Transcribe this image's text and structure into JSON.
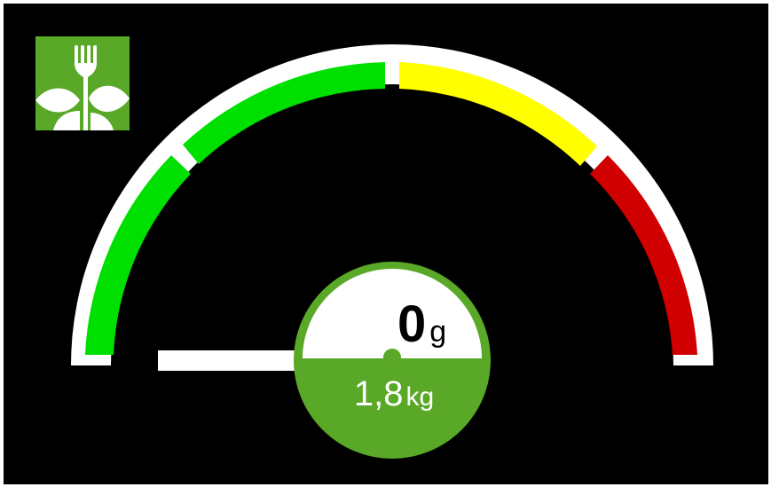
{
  "gauge": {
    "zones": [
      {
        "name": "low",
        "color": "#00e000"
      },
      {
        "name": "mid",
        "color": "#ffff00"
      },
      {
        "name": "high",
        "color": "#d00000"
      }
    ],
    "level_fraction": 0.0,
    "border_color": "#ffffff"
  },
  "readout": {
    "value": "0",
    "unit": "g",
    "total_value": "1,8",
    "total_unit": "kg",
    "accent_color": "#5aa827"
  },
  "logo": {
    "icon": "fork-leaves-icon",
    "color": "#5aa827"
  }
}
